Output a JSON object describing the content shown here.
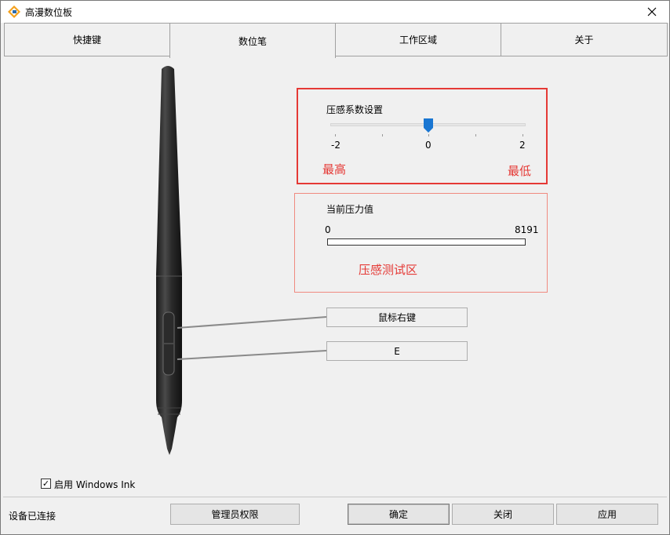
{
  "window": {
    "title": "高漫数位板",
    "icon": "app-logo-icon",
    "close_icon": "close-icon"
  },
  "tabs": [
    {
      "label": "快捷键",
      "active": false
    },
    {
      "label": "数位笔",
      "active": true
    },
    {
      "label": "工作区域",
      "active": false
    },
    {
      "label": "关于",
      "active": false
    }
  ],
  "pressure_setting": {
    "label": "压感系数设置",
    "min_label": "-2",
    "mid_label": "0",
    "max_label": "2",
    "value": 0,
    "left_hint": "最高",
    "right_hint": "最低",
    "accent": "#1976d2"
  },
  "pressure_test": {
    "label": "当前压力值",
    "min_label": "0",
    "max_label": "8191",
    "value": 0,
    "area_label": "压感测试区"
  },
  "pen_buttons": {
    "upper": "鼠标右键",
    "lower": "E"
  },
  "windows_ink": {
    "label": "启用 Windows Ink",
    "checked": true,
    "check_mark": "☑"
  },
  "status": {
    "text": "设备已连接"
  },
  "buttons": {
    "admin": "管理员权限",
    "ok": "确定",
    "close": "关闭",
    "apply": "应用"
  },
  "colors": {
    "highlight_red": "#e53935",
    "outline_pink": "#f08a80"
  }
}
